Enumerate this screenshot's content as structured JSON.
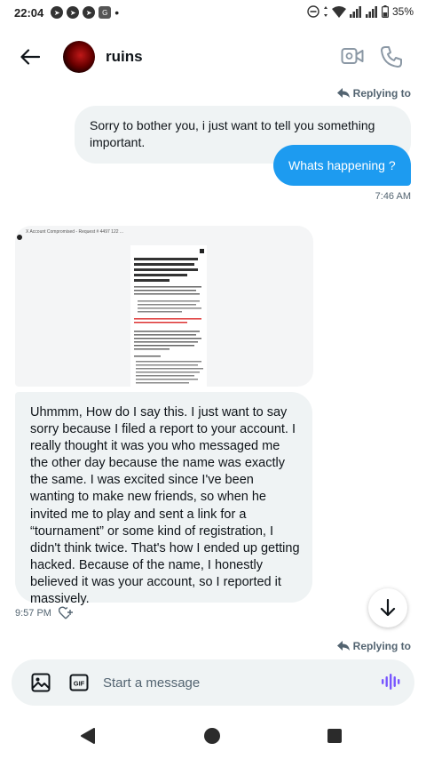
{
  "status_bar": {
    "time": "22:04",
    "battery": "35%"
  },
  "header": {
    "contact_name": "ruins"
  },
  "messages": [
    {
      "replying_label": "Replying to",
      "text": "Sorry to bother you, i just want to tell you something important.",
      "side": "left"
    },
    {
      "text": "Whats happening ?",
      "side": "right",
      "timestamp": "7:46 AM"
    },
    {
      "attachment": {
        "browser_title": "X Account Compromised - Request # 4497 122 ..."
      },
      "text": "Uhmmm, How do I say this. I just want to say sorry because I filed a report to  your account. I really thought it was you who messaged me the other day because the name was exactly the same. I was excited since I've been wanting to make new friends, so when he invited me to play and sent a link for a “tournament” or some kind of registration, I didn't think twice. That's how I ended up getting hacked. Because of the name, I honestly believed it was your account, so I reported it massively.",
      "side": "left",
      "timestamp": "9:57 PM"
    }
  ],
  "bottom_reply": {
    "replying_label": "Replying to"
  },
  "composer": {
    "placeholder": "Start a message"
  },
  "colors": {
    "accent": "#1d9bf0",
    "bubble_gray": "#eff3f4",
    "secondary_text": "#536471",
    "voice_icon": "#7856ff"
  }
}
